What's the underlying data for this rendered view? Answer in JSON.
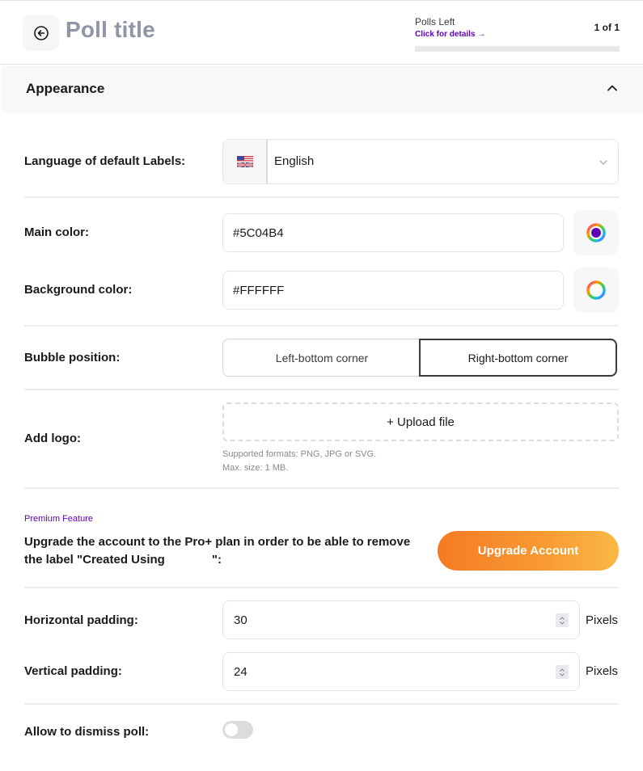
{
  "header": {
    "title": "Poll title",
    "polls_left_label": "Polls Left",
    "details_link": "Click for details →",
    "polls_count": "1 of 1",
    "polls_used_fraction": 1.0
  },
  "section": {
    "title": "Appearance",
    "expanded": true
  },
  "language": {
    "label": "Language of default Labels:",
    "value": "English",
    "flag_icon": "us-uk-flag-icon"
  },
  "main_color": {
    "label": "Main color:",
    "value": "#5C04B4",
    "swatch": "#5C04B4"
  },
  "background_color": {
    "label": "Background color:",
    "value": "#FFFFFF",
    "swatch": "#FFFFFF"
  },
  "bubble_position": {
    "label": "Bubble position:",
    "options": [
      "Left-bottom corner",
      "Right-bottom corner"
    ],
    "selected": "Right-bottom corner"
  },
  "logo": {
    "label": "Add logo:",
    "upload_label": "+ Upload file",
    "hint_formats": "Supported formats: PNG, JPG or SVG.",
    "hint_size": "Max. size: 1 MB."
  },
  "premium": {
    "tag": "Premium Feature",
    "text_line1": "Upgrade the account to the Pro+ plan in order to be able to remove",
    "text_line2_start": "the label \"Created Using",
    "text_line2_end": "\":",
    "button_label": "Upgrade Account"
  },
  "horizontal_padding": {
    "label": "Horizontal padding:",
    "value": "30",
    "unit": "Pixels"
  },
  "vertical_padding": {
    "label": "Vertical padding:",
    "value": "24",
    "unit": "Pixels"
  },
  "dismiss": {
    "label": "Allow to dismiss poll:",
    "enabled": false
  },
  "colors": {
    "accent": "#5C04B4",
    "upgrade_start": "#F57A24",
    "upgrade_end": "#FBB845"
  }
}
